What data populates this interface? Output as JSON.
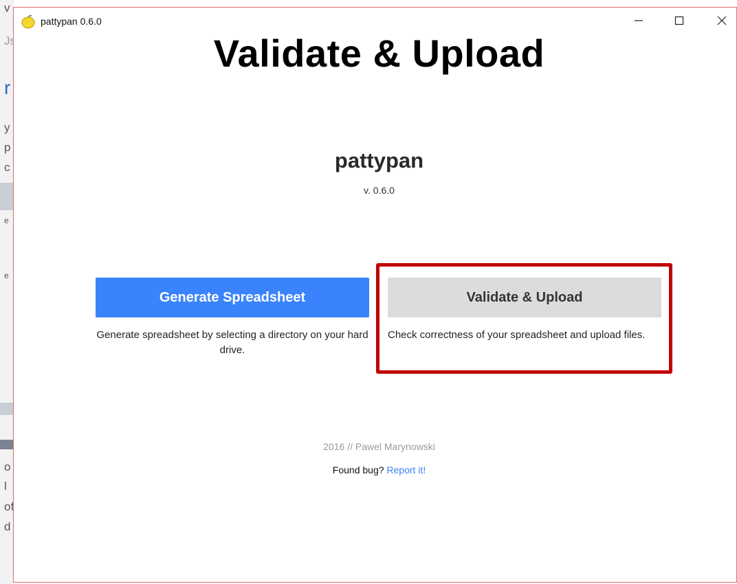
{
  "window": {
    "title": "pattypan 0.6.0",
    "controls": [
      "minimize-icon",
      "maximize-icon",
      "close-icon"
    ]
  },
  "overlay_heading": "Validate & Upload",
  "app": {
    "name": "pattypan",
    "version": "v. 0.6.0"
  },
  "actions": {
    "generate": {
      "label": "Generate Spreadsheet",
      "description": "Generate spreadsheet by selecting a directory on your hard drive."
    },
    "validate": {
      "label": "Validate & Upload",
      "description": "Check correctness of your spreadsheet and upload files."
    }
  },
  "footer": {
    "credit": "2016 // Pawel Marynowski",
    "bug_prompt": "Found bug?",
    "report_link": "Report it!"
  },
  "background_window_fragments": [
    "v",
    "Js",
    "r",
    "y",
    "p",
    "c",
    "e",
    "e",
    "o",
    "l",
    "of",
    "d"
  ],
  "colors": {
    "primary_button": "#3b83fc",
    "secondary_button": "#dcdcdc",
    "highlight_border": "#c00000",
    "link": "#3b83fc"
  }
}
